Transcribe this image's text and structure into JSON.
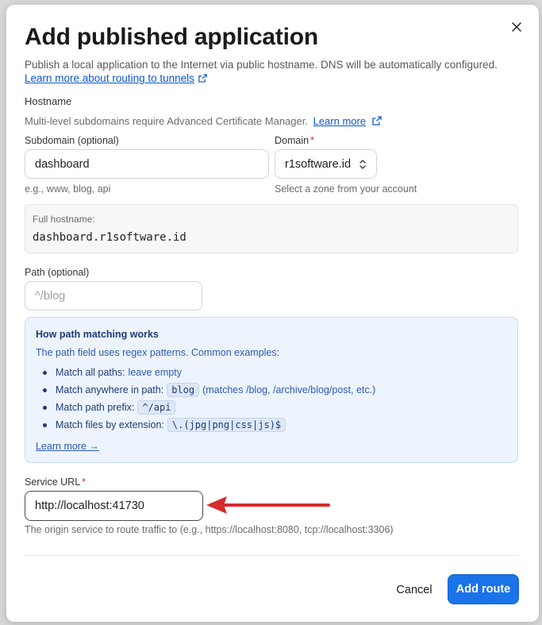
{
  "modal": {
    "title": "Add published application",
    "subtitle": "Publish a local application to the Internet via public hostname. DNS will be automatically configured.",
    "subtitle_link": "Learn more about routing to tunnels"
  },
  "hostname": {
    "section_label": "Hostname",
    "note": "Multi-level subdomains require Advanced Certificate Manager.",
    "note_link": "Learn more",
    "subdomain": {
      "label": "Subdomain (optional)",
      "value": "dashboard",
      "help": "e.g., www, blog, api"
    },
    "domain": {
      "label": "Domain",
      "required_mark": "*",
      "value": "r1software.id",
      "help": "Select a zone from your account"
    },
    "full": {
      "label": "Full hostname:",
      "value": "dashboard.r1software.id"
    }
  },
  "path": {
    "label": "Path (optional)",
    "value": "",
    "placeholder": "^/blog"
  },
  "path_info": {
    "title": "How path matching works",
    "description": "The path field uses regex patterns. Common examples:",
    "items": [
      {
        "label": "Match all paths:",
        "desc": "leave empty",
        "code": ""
      },
      {
        "label": "Match anywhere in path:",
        "code": "blog",
        "desc": "(matches /blog, /archive/blog/post, etc.)"
      },
      {
        "label": "Match path prefix:",
        "code": "^/api",
        "desc": ""
      },
      {
        "label": "Match files by extension:",
        "code": "\\.(jpg|png|css|js)$",
        "desc": ""
      }
    ],
    "link": "Learn more →"
  },
  "service": {
    "label": "Service URL",
    "required_mark": "*",
    "value": "http://localhost:41730",
    "help": "The origin service to route traffic to (e.g., https://localhost:8080, tcp://localhost:3306)"
  },
  "footer": {
    "cancel_label": "Cancel",
    "submit_label": "Add route"
  },
  "colors": {
    "primary": "#1a73e8",
    "link": "#0b57d0",
    "info_bg": "#eef4fd",
    "annotation_arrow": "#d62b2b"
  }
}
